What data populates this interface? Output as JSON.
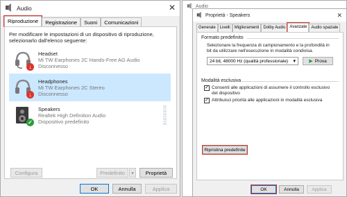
{
  "left_window": {
    "title": "Audio",
    "tabs": [
      {
        "label": "Riproduzione",
        "active": true
      },
      {
        "label": "Registrazione",
        "active": false
      },
      {
        "label": "Suoni",
        "active": false
      },
      {
        "label": "Comunicazioni",
        "active": false
      }
    ],
    "description": "Per modificare le impostazioni di un dispositivo di riproduzione, selezionarlo dall'elenco seguente:",
    "devices": [
      {
        "name": "Headset",
        "detail": "Mi TW Earphones 2C Hands-Free AG Audio",
        "status": "Disconnesso",
        "icon": "headset-icon",
        "badge": "disconnected-badge",
        "selected": false
      },
      {
        "name": "Headphones",
        "detail": "Mi TW Earphones 2C Stereo",
        "status": "Disconnesso",
        "icon": "headphones-icon",
        "badge": "disconnected-badge",
        "selected": true
      },
      {
        "name": "Speakers",
        "detail": "Realtek High Definition Audio",
        "status": "Dispositivo predefinito",
        "icon": "speaker-icon",
        "badge": "default-check-badge",
        "selected": false
      }
    ],
    "buttons": {
      "configure": "Configura",
      "default": "Predefinito",
      "properties": "Proprietà",
      "ok": "OK",
      "cancel": "Annulla",
      "apply": "Applica"
    }
  },
  "right_window": {
    "background_title": "Audio",
    "title": "Proprietà - Speakers",
    "tabs": [
      {
        "label": "Generale",
        "active": false
      },
      {
        "label": "Livelli",
        "active": false
      },
      {
        "label": "Miglioramenti",
        "active": false
      },
      {
        "label": "Dolby Audio",
        "active": false
      },
      {
        "label": "Avanzate",
        "active": true
      },
      {
        "label": "Audio spaziale",
        "active": false
      }
    ],
    "default_format": {
      "title": "Formato predefinito",
      "description": "Selezionare la frequenza di campionamento e la profondità in bit da utilizzare nell'esecuzione in modalità condivisa.",
      "selected_value": "24 bit, 48000 Hz (qualità professionale)",
      "test_button": "Prova"
    },
    "exclusive_mode": {
      "title": "Modalità esclusiva",
      "options": [
        {
          "label": "Consenti alle applicazioni di assumere il controllo esclusivo del dispositivo",
          "checked": true
        },
        {
          "label": "Attribuisci priorità alle applicazioni in modalità esclusiva",
          "checked": true
        }
      ]
    },
    "buttons": {
      "restore_defaults": "Ripristina predefinite",
      "ok": "OK",
      "cancel": "Annulla",
      "apply": "Applica"
    }
  },
  "colors": {
    "highlight_red": "#d9352e",
    "selection_blue": "#cce8ff",
    "accent_blue": "#0078d7",
    "play_green": "#2a9d3a"
  }
}
